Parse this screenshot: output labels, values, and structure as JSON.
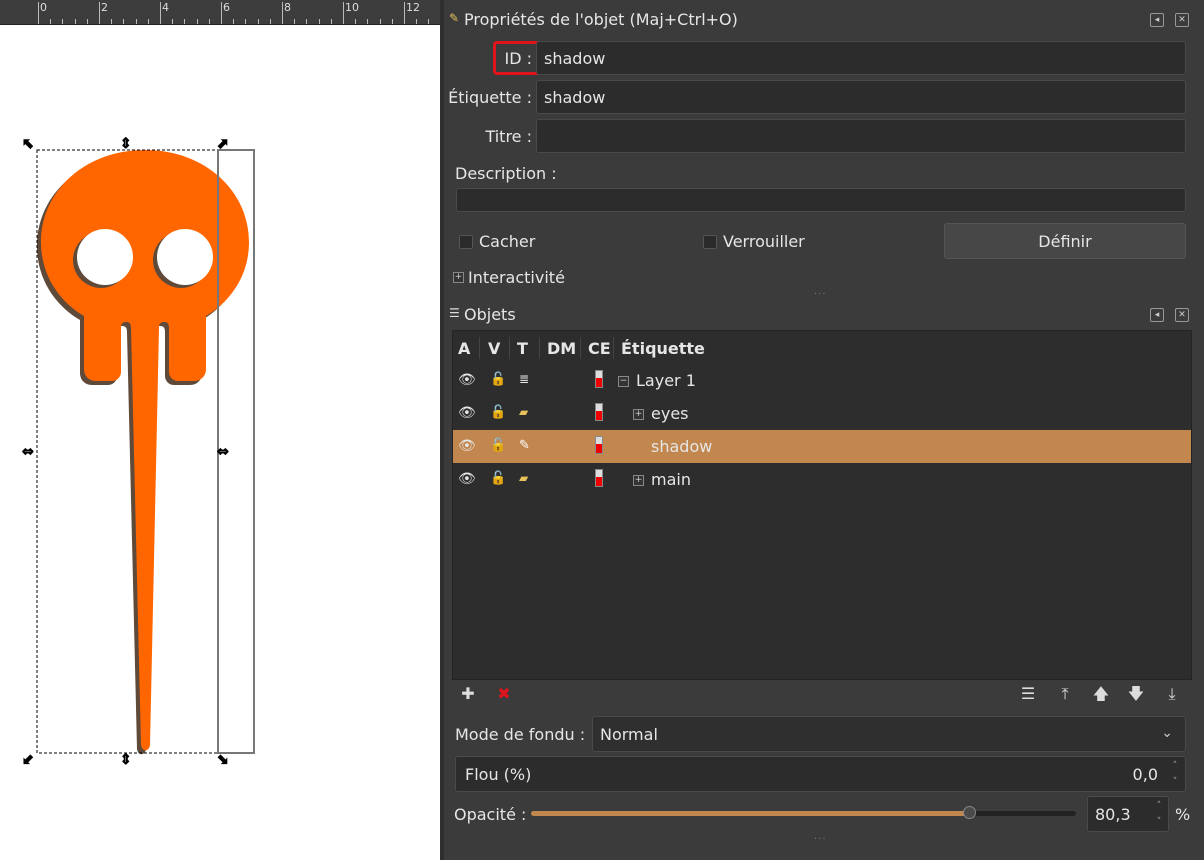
{
  "ruler": {
    "labels": [
      "0",
      "2",
      "4",
      "6",
      "8",
      "10",
      "12"
    ]
  },
  "properties_panel": {
    "title": "Propriétés de l'objet (Maj+Ctrl+O)",
    "id_label": "ID :",
    "id_value": "shadow",
    "label_label": "Étiquette :",
    "label_value": "shadow",
    "title_label": "Titre :",
    "title_value": "",
    "description_label": "Description :",
    "description_value": "",
    "hide_label": "Cacher",
    "lock_label": "Verrouiller",
    "set_button": "Définir",
    "interactivity_label": "Interactivité"
  },
  "objects_panel": {
    "title": "Objets",
    "columns": [
      "A",
      "V",
      "T",
      "DM",
      "CE",
      "Étiquette"
    ],
    "rows": [
      {
        "label": "Layer 1",
        "type": "layer",
        "expander": "−",
        "selected": false
      },
      {
        "label": "eyes",
        "type": "group",
        "expander": "+",
        "selected": false
      },
      {
        "label": "shadow",
        "type": "path",
        "expander": "",
        "selected": true
      },
      {
        "label": "main",
        "type": "group",
        "expander": "+",
        "selected": false
      }
    ],
    "blend_mode_label": "Mode de fondu :",
    "blend_mode_value": "Normal",
    "blur_label": "Flou (%)",
    "blur_value": "0,0",
    "opacity_label": "Opacité :",
    "opacity_value": "80,3",
    "opacity_fraction": 0.803,
    "opacity_unit": "%"
  },
  "colors": {
    "accent": "#c2874f",
    "skull_fill": "#ff6600",
    "shadow_fill": "#5f4a3a",
    "highlight_box": "#e0141c"
  }
}
